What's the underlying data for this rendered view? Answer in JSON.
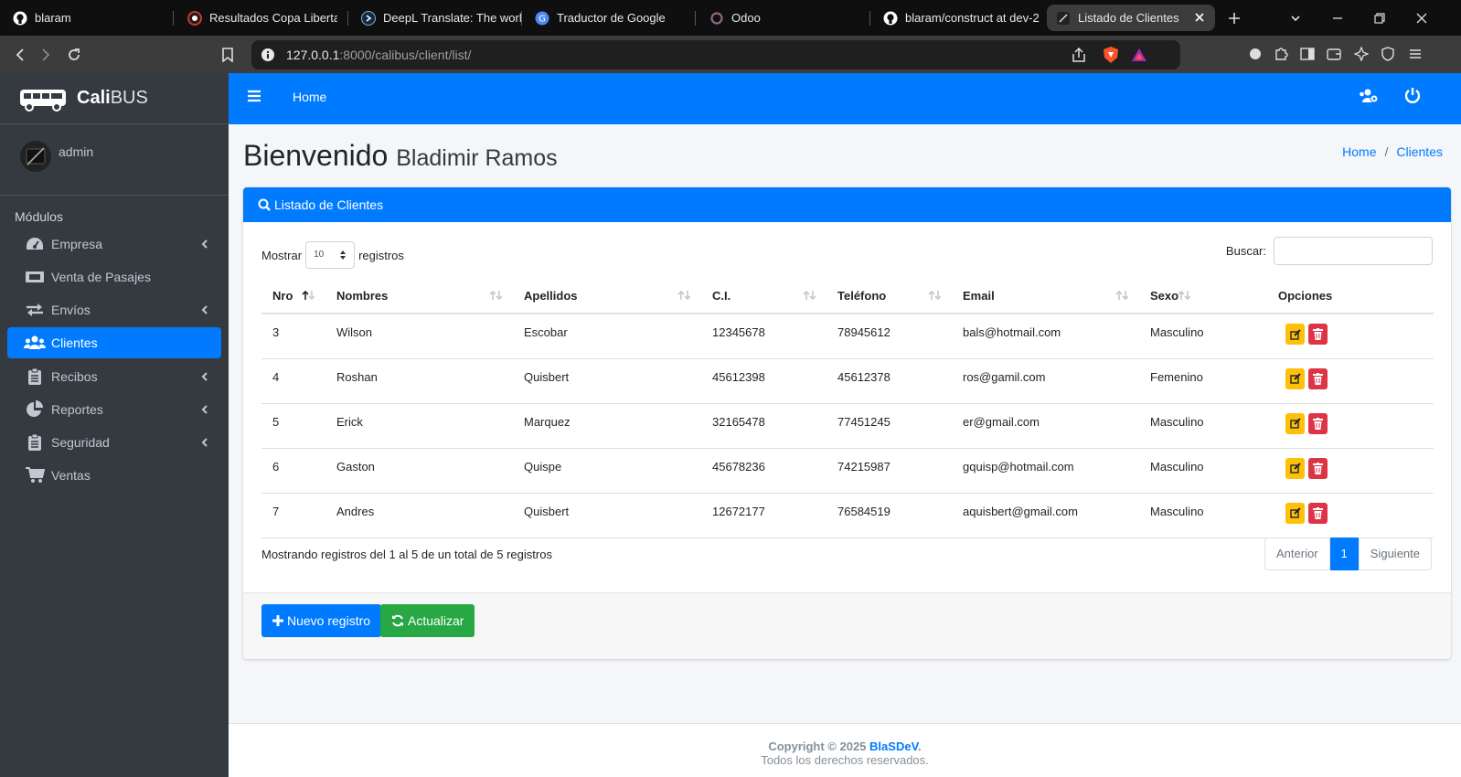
{
  "browser": {
    "tabs": [
      {
        "title": "blaram"
      },
      {
        "title": "Resultados Copa Libertadores"
      },
      {
        "title": "DeepL Translate: The world"
      },
      {
        "title": "Traductor de Google"
      },
      {
        "title": "Odoo"
      },
      {
        "title": "blaram/construct at dev-2"
      },
      {
        "title": "Listado de Clientes",
        "active": true
      }
    ],
    "url_host": "127.0.0.1",
    "url_rest": ":8000/calibus/client/list/"
  },
  "app": {
    "brand_bold": "Cali",
    "brand_light": "BUS",
    "user_name": "admin",
    "modules_header": "Módulos",
    "menu": [
      {
        "label": "Empresa",
        "icon": "tachometer-icon",
        "has_submenu": true
      },
      {
        "label": "Venta de Pasajes",
        "icon": "ticket-icon",
        "has_submenu": false
      },
      {
        "label": "Envíos",
        "icon": "exchange-icon",
        "has_submenu": true
      },
      {
        "label": "Clientes",
        "icon": "users-icon",
        "has_submenu": false,
        "active": true
      },
      {
        "label": "Recibos",
        "icon": "clipboard-icon",
        "has_submenu": true
      },
      {
        "label": "Reportes",
        "icon": "pie-chart-icon",
        "has_submenu": true
      },
      {
        "label": "Seguridad",
        "icon": "clipboard-icon",
        "has_submenu": true
      },
      {
        "label": "Ventas",
        "icon": "cart-icon",
        "has_submenu": false
      }
    ],
    "topnav_home": "Home"
  },
  "page": {
    "welcome": "Bienvenido",
    "welcome_name": "Bladimir Ramos",
    "breadcrumb": [
      "Home",
      "Clientes"
    ],
    "card_title": "Listado de Clientes",
    "length_label_before": "Mostrar",
    "length_value": "10",
    "length_label_after": "registros",
    "search_label": "Buscar:",
    "search_value": "",
    "columns": [
      "Nro",
      "Nombres",
      "Apellidos",
      "C.I.",
      "Teléfono",
      "Email",
      "Sexo",
      "Opciones"
    ],
    "rows": [
      {
        "nro": "3",
        "nombres": "Wilson",
        "apellidos": "Escobar",
        "ci": "12345678",
        "telefono": "78945612",
        "email": "bals@hotmail.com",
        "sexo": "Masculino"
      },
      {
        "nro": "4",
        "nombres": "Roshan",
        "apellidos": "Quisbert",
        "ci": "45612398",
        "telefono": "45612378",
        "email": "ros@gamil.com",
        "sexo": "Femenino"
      },
      {
        "nro": "5",
        "nombres": "Erick",
        "apellidos": "Marquez",
        "ci": "32165478",
        "telefono": "77451245",
        "email": "er@gmail.com",
        "sexo": "Masculino"
      },
      {
        "nro": "6",
        "nombres": "Gaston",
        "apellidos": "Quispe",
        "ci": "45678236",
        "telefono": "74215987",
        "email": "gquisp@hotmail.com",
        "sexo": "Masculino"
      },
      {
        "nro": "7",
        "nombres": "Andres",
        "apellidos": "Quisbert",
        "ci": "12672177",
        "telefono": "76584519",
        "email": "aquisbert@gmail.com",
        "sexo": "Masculino"
      }
    ],
    "info": "Mostrando registros del 1 al 5 de un total de 5 registros",
    "pager": {
      "prev": "Anterior",
      "current": "1",
      "next": "Siguiente"
    },
    "btn_new": "Nuevo registro",
    "btn_refresh": "Actualizar"
  },
  "footer": {
    "copyright": "Copyright © 2025",
    "author": "BlaSDeV",
    "period": ".",
    "rights": "Todos los derechos reservados."
  },
  "colors": {
    "primary": "#007bff",
    "success": "#28a745",
    "warning": "#ffc107",
    "danger": "#dc3545",
    "sidebar": "#343a40"
  }
}
